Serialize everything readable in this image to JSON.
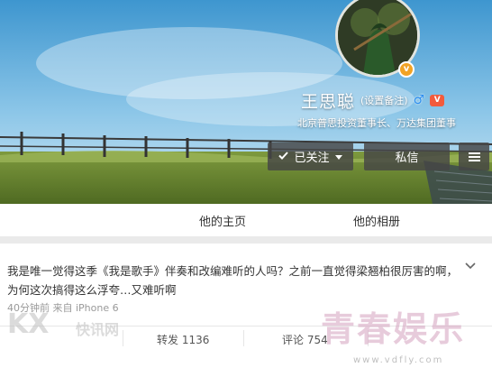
{
  "profile": {
    "name": "王思聪",
    "remark": "(设置备注)",
    "gender_symbol": "♂",
    "verified_symbol": "v",
    "vip_symbol": "V",
    "bio": "北京普思投资董事长、万达集团董事",
    "follow_label": "已关注",
    "message_label": "私信"
  },
  "tabs": {
    "home": "他的主页",
    "album": "他的相册"
  },
  "post": {
    "text": "我是唯一觉得这季《我是歌手》伴奏和改编难听的人吗？之前一直觉得梁翘柏很厉害的啊，为何这次搞得这么浮夸…又难听啊",
    "meta": "40分钟前 来自 iPhone 6",
    "repost": "转发 1136",
    "comment": "评论 754"
  },
  "watermarks": {
    "left_logo": "KX",
    "left_text": "快讯网",
    "right_logo": "青春娱乐",
    "right_url": "www.vdfly.com"
  },
  "icons": [
    "check-icon",
    "caret-down-icon",
    "menu-icon",
    "chevron-down-icon",
    "verified-badge-icon",
    "male-icon",
    "vip-icon"
  ],
  "colors": {
    "button_bg": "#464646",
    "verify_badge": "#f1a325",
    "gender": "#2d8ff0"
  }
}
